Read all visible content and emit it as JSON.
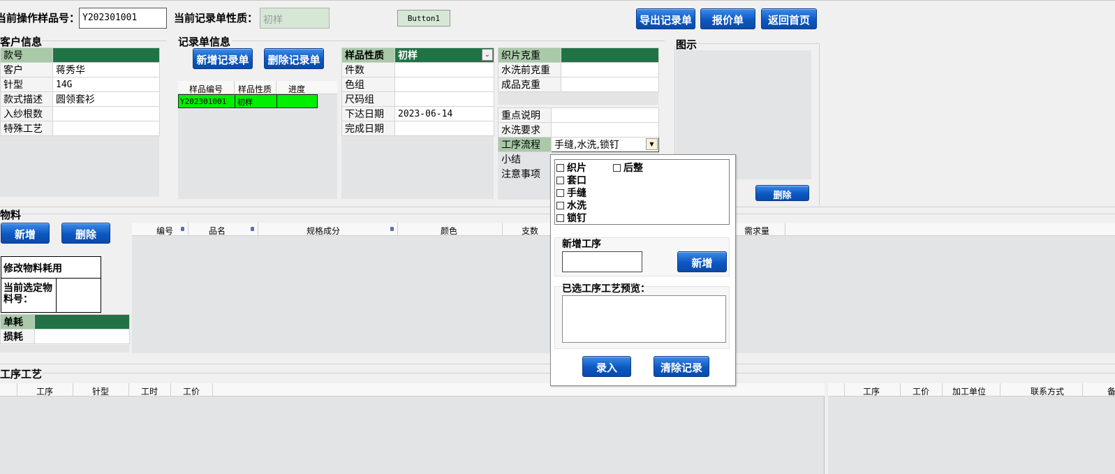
{
  "top": {
    "sample_label": "当前操作样品号：",
    "sample_value": "Y202301001",
    "nature_label": "当前记录单性质：",
    "nature_value": "初样",
    "button1": "Button1",
    "export_btn": "导出记录单",
    "quote_btn": "报价单",
    "home_btn": "返回首页"
  },
  "customer": {
    "title": "客户信息",
    "rows": [
      {
        "k": "款号",
        "v": ""
      },
      {
        "k": "客户",
        "v": "蒋秀华"
      },
      {
        "k": "针型",
        "v": "14G"
      },
      {
        "k": "款式描述",
        "v": "圆领套衫"
      },
      {
        "k": "入纱根数",
        "v": ""
      },
      {
        "k": "特殊工艺",
        "v": ""
      }
    ]
  },
  "record": {
    "title": "记录单信息",
    "add_btn": "新增记录单",
    "del_btn": "删除记录单",
    "list_headers": [
      "样品编号",
      "样品性质",
      "进度"
    ],
    "list_rows": [
      {
        "id": "Y202301001",
        "nature": "初样",
        "progress": ""
      }
    ],
    "fields": [
      {
        "k": "样品性质",
        "v": "初样"
      },
      {
        "k": "件数",
        "v": ""
      },
      {
        "k": "色组",
        "v": ""
      },
      {
        "k": "尺码组",
        "v": ""
      },
      {
        "k": "下达日期",
        "v": "2023-06-14"
      },
      {
        "k": "完成日期",
        "v": ""
      }
    ],
    "weights": [
      {
        "k": "织片克重",
        "v": ""
      },
      {
        "k": "水洗前克重",
        "v": ""
      },
      {
        "k": "成品克重",
        "v": ""
      }
    ],
    "notes": [
      {
        "k": "重点说明",
        "v": ""
      },
      {
        "k": "水洗要求",
        "v": ""
      },
      {
        "k": "工序流程",
        "v": "手缝,水洗,锁钉"
      },
      {
        "k": "小结",
        "v": ""
      },
      {
        "k": "注意事项",
        "v": ""
      }
    ]
  },
  "diagram": {
    "title": "图示",
    "delete_btn": "删除"
  },
  "materials": {
    "title": "物料",
    "add_btn": "新增",
    "del_btn": "删除",
    "modify_title": "修改物料耗用",
    "current_label": "当前选定物料号：",
    "current_value": "",
    "usage": [
      {
        "k": "单耗",
        "v": ""
      },
      {
        "k": "损耗",
        "v": ""
      }
    ],
    "headers": [
      "编号",
      "品名",
      "规格成分",
      "颜色",
      "支数",
      "需求量"
    ]
  },
  "process": {
    "title": "工序工艺",
    "left_headers": [
      "工序",
      "针型",
      "工时",
      "工价"
    ],
    "right_headers": [
      "工序",
      "工价",
      "加工单位",
      "联系方式",
      "备"
    ]
  },
  "popup": {
    "options": [
      {
        "label": "织片",
        "checked": false
      },
      {
        "label": "后整",
        "checked": false
      },
      {
        "label": "套口",
        "checked": false
      },
      {
        "label": "手缝",
        "checked": false
      },
      {
        "label": "水洗",
        "checked": false
      },
      {
        "label": "锁钉",
        "checked": false
      }
    ],
    "new_title": "新增工序",
    "new_input": "",
    "new_btn": "新增",
    "preview_title": "已选工序工艺预览：",
    "preview_value": "",
    "enter_btn": "录入",
    "clear_btn": "清除记录"
  },
  "colors": {
    "selected_cell": "#217346",
    "list_row_highlight": "#00ee00",
    "button_blue": "#0c58c2"
  }
}
